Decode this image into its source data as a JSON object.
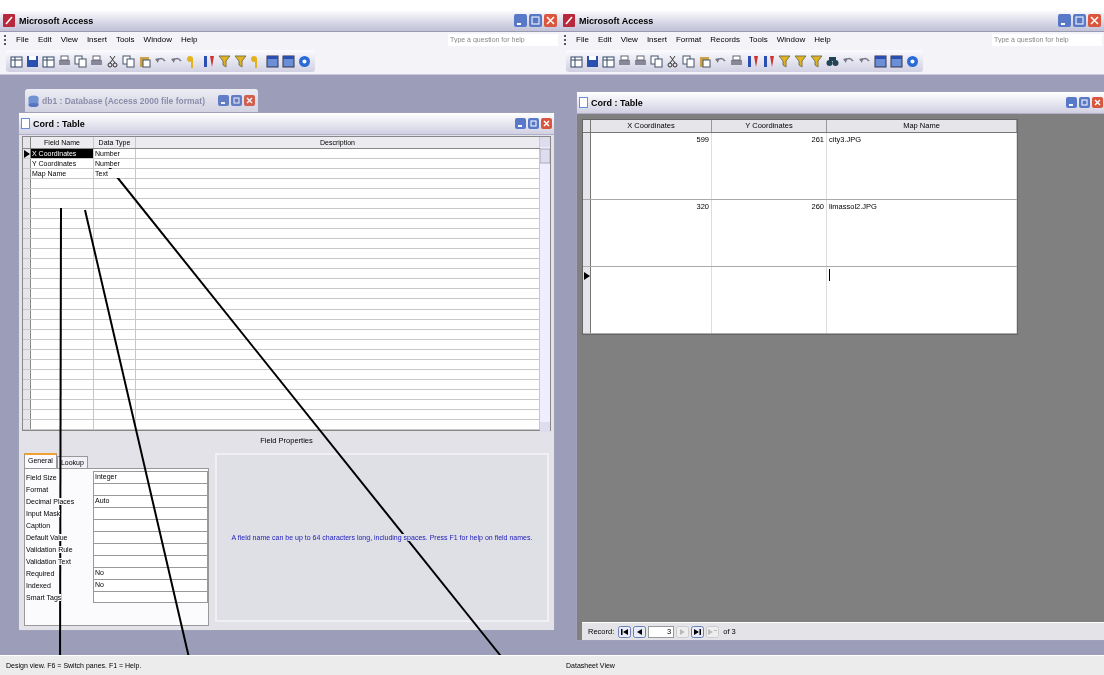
{
  "windows": [
    {
      "title": "Microsoft Access",
      "menu": [
        "File",
        "Edit",
        "View",
        "Insert",
        "Tools",
        "Window",
        "Help"
      ],
      "help_box": {
        "placeholder": "Type a question for help"
      },
      "database_window": {
        "title": "db1 : Database (Access 2000 file format)"
      },
      "table_window": {
        "title": "Cord : Table",
        "kind": "design",
        "columns": [
          "Field Name",
          "Data Type",
          "Description"
        ],
        "rows": [
          {
            "field_name": "X Coordinates",
            "data_type": "Number",
            "selected": true
          },
          {
            "field_name": "Y Coordinates",
            "data_type": "Number",
            "selected": false
          },
          {
            "field_name": "Map Name",
            "data_type": "Text",
            "selected": false
          }
        ],
        "properties_title": "Field Properties",
        "tabs": [
          {
            "label": "General",
            "selected": true
          },
          {
            "label": "Lookup",
            "selected": false
          }
        ],
        "properties": [
          {
            "label": "Field Size",
            "value": "Integer"
          },
          {
            "label": "Format"
          },
          {
            "label": "Decimal Places",
            "value": "Auto"
          },
          {
            "label": "Input Mask"
          },
          {
            "label": "Caption"
          },
          {
            "label": "Default Value"
          },
          {
            "label": "Validation Rule"
          },
          {
            "label": "Validation Text"
          },
          {
            "label": "Required",
            "value": "No"
          },
          {
            "label": "Indexed",
            "value": "No"
          },
          {
            "label": "Smart Tags"
          }
        ],
        "help_text": "A field name can be up to 64 characters long, including spaces.  Press F1 for help on field names."
      },
      "status_bar": "Design view.  F6 = Switch panes.  F1 = Help."
    },
    {
      "title": "Microsoft Access",
      "menu": [
        "File",
        "Edit",
        "View",
        "Insert",
        "Format",
        "Records",
        "Tools",
        "Window",
        "Help"
      ],
      "help_box": {
        "placeholder": "Type a question for help"
      },
      "table_window": {
        "title": "Cord : Table",
        "kind": "datasheet",
        "columns": [
          "X Coordinates",
          "Y Coordinates",
          "Map Name"
        ],
        "rows": [
          {
            "cells": [
              "599",
              "261",
              "city3.JPG"
            ],
            "current": false
          },
          {
            "cells": [
              "320",
              "260",
              "limassol2.JPG"
            ],
            "current": false
          },
          {
            "cells": [
              "",
              "",
              ""
            ],
            "current": true
          }
        ],
        "record_nav": {
          "label": "Record:",
          "value": "3",
          "total": "of 3"
        }
      },
      "status_bar": "Datasheet View"
    }
  ]
}
